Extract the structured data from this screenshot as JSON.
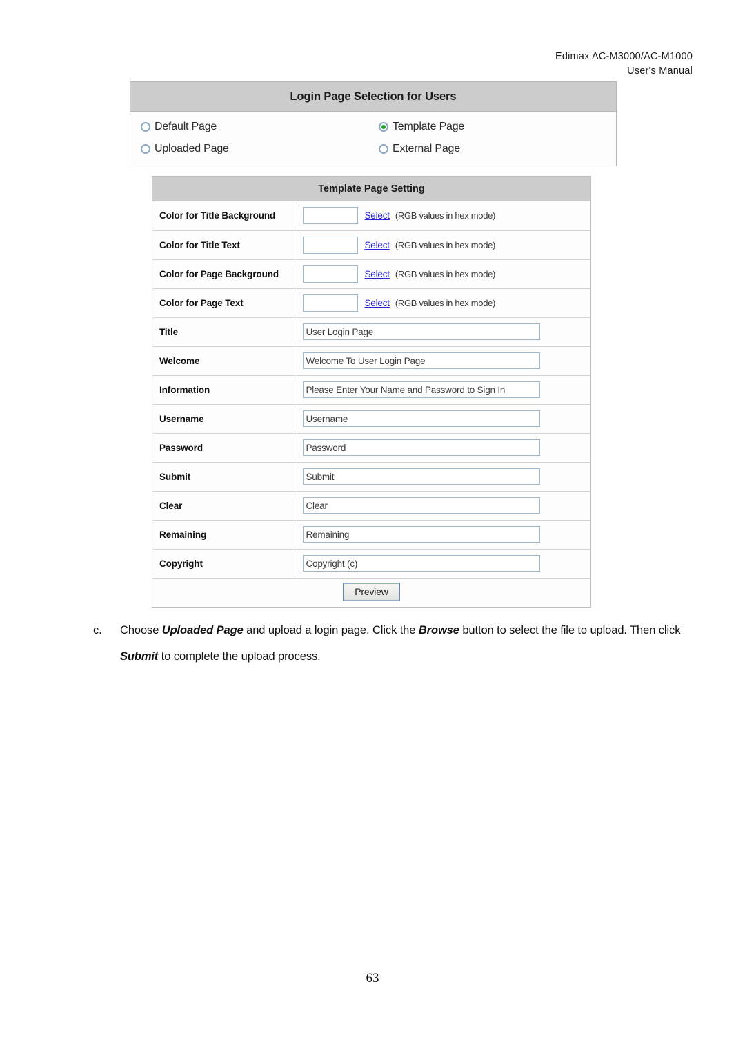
{
  "document": {
    "header_line1": "Edimax  AC-M3000/AC-M1000",
    "header_line2": "User's  Manual",
    "page_number": "63"
  },
  "login_page_selection": {
    "title": "Login Page Selection for Users",
    "options": [
      {
        "label": "Default Page",
        "selected": false
      },
      {
        "label": "Template Page",
        "selected": true
      },
      {
        "label": "Uploaded Page",
        "selected": false
      },
      {
        "label": "External Page",
        "selected": false
      }
    ]
  },
  "template_page_setting": {
    "title": "Template Page Setting",
    "hex_note": "(RGB values in hex mode)",
    "select_link_label": "Select",
    "color_rows": [
      {
        "label": "Color for Title Background",
        "value": ""
      },
      {
        "label": "Color for Title Text",
        "value": ""
      },
      {
        "label": "Color for Page Background",
        "value": ""
      },
      {
        "label": "Color for Page Text",
        "value": ""
      }
    ],
    "text_rows": [
      {
        "label": "Title",
        "value": "User Login Page"
      },
      {
        "label": "Welcome",
        "value": "Welcome To User Login Page"
      },
      {
        "label": "Information",
        "value": "Please Enter Your Name and Password to Sign In"
      },
      {
        "label": "Username",
        "value": "Username"
      },
      {
        "label": "Password",
        "value": "Password"
      },
      {
        "label": "Submit",
        "value": "Submit"
      },
      {
        "label": "Clear",
        "value": "Clear"
      },
      {
        "label": "Remaining",
        "value": "Remaining"
      },
      {
        "label": "Copyright",
        "value": "Copyright (c)"
      }
    ],
    "preview_button_label": "Preview"
  },
  "instruction": {
    "marker": "c.",
    "segment1": "Choose ",
    "emphasis1": "Uploaded Page",
    "segment2": " and upload a login page. Click the ",
    "emphasis2": "Browse",
    "segment3": " button to select the file to upload. Then click ",
    "emphasis3": "Submit",
    "segment4": " to complete the upload process."
  },
  "colors": {
    "panel_header_bg": "#cccccc",
    "radio_selected_dot": "#1aaa22",
    "link_blue": "#2424dd",
    "input_border": "#9db8cd"
  }
}
